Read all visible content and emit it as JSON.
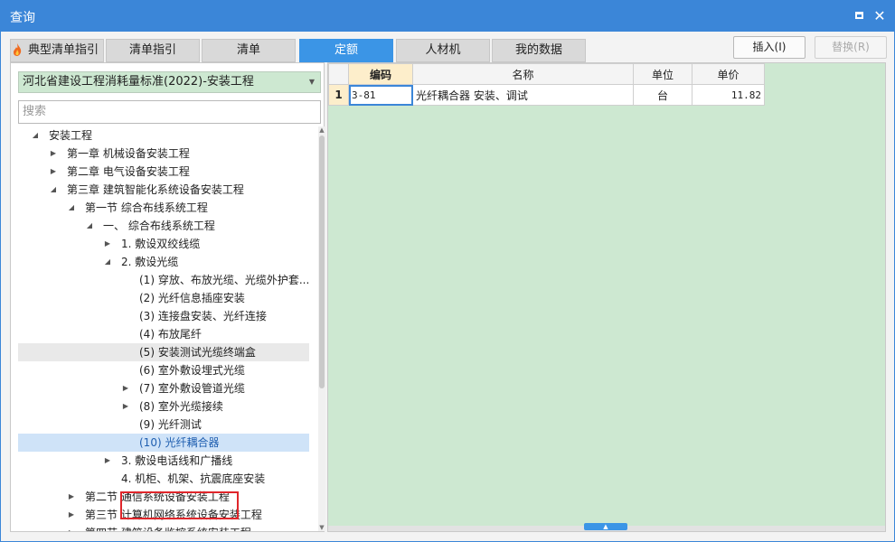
{
  "window": {
    "title": "查询"
  },
  "tabs": [
    {
      "label": "典型清单指引",
      "active": false
    },
    {
      "label": "清单指引",
      "active": false
    },
    {
      "label": "清单",
      "active": false
    },
    {
      "label": "定额",
      "active": true
    },
    {
      "label": "人材机",
      "active": false
    },
    {
      "label": "我的数据",
      "active": false
    }
  ],
  "actions": {
    "insert": "插入(I)",
    "replace": "替换(R)"
  },
  "library": {
    "selected": "河北省建设工程消耗量标准(2022)-安装工程"
  },
  "search": {
    "placeholder": "搜索"
  },
  "tree": [
    {
      "label": "安装工程",
      "indent": 0,
      "arrow": "expanded"
    },
    {
      "label": "第一章 机械设备安装工程",
      "indent": 1,
      "arrow": "collapsed"
    },
    {
      "label": "第二章 电气设备安装工程",
      "indent": 1,
      "arrow": "collapsed"
    },
    {
      "label": "第三章 建筑智能化系统设备安装工程",
      "indent": 1,
      "arrow": "expanded"
    },
    {
      "label": "第一节 综合布线系统工程",
      "indent": 2,
      "arrow": "expanded"
    },
    {
      "label": "一、 综合布线系统工程",
      "indent": 3,
      "arrow": "expanded"
    },
    {
      "label": "1. 敷设双绞线缆",
      "indent": 4,
      "arrow": "collapsed"
    },
    {
      "label": "2. 敷设光缆",
      "indent": 4,
      "arrow": "expanded"
    },
    {
      "label": "(1) 穿放、布放光缆、光缆外护套...",
      "indent": 5,
      "arrow": "none"
    },
    {
      "label": "(2) 光纤信息插座安装",
      "indent": 5,
      "arrow": "none"
    },
    {
      "label": "(3) 连接盘安装、光纤连接",
      "indent": 5,
      "arrow": "none"
    },
    {
      "label": "(4) 布放尾纤",
      "indent": 5,
      "arrow": "none"
    },
    {
      "label": "(5) 安装测试光缆终端盒",
      "indent": 5,
      "arrow": "none",
      "state": "hover"
    },
    {
      "label": "(6) 室外敷设埋式光缆",
      "indent": 5,
      "arrow": "none"
    },
    {
      "label": "(7) 室外敷设管道光缆",
      "indent": 5,
      "arrow": "collapsed"
    },
    {
      "label": "(8) 室外光缆接续",
      "indent": 5,
      "arrow": "collapsed"
    },
    {
      "label": "(9) 光纤测试",
      "indent": 5,
      "arrow": "none"
    },
    {
      "label": "(10) 光纤耦合器",
      "indent": 5,
      "arrow": "none",
      "state": "selected"
    },
    {
      "label": "3. 敷设电话线和广播线",
      "indent": 4,
      "arrow": "collapsed"
    },
    {
      "label": "4. 机柜、机架、抗震底座安装",
      "indent": 4,
      "arrow": "none"
    },
    {
      "label": "第二节 通信系统设备安装工程",
      "indent": 2,
      "arrow": "collapsed"
    },
    {
      "label": "第三节 计算机网络系统设备安装工程",
      "indent": 2,
      "arrow": "collapsed"
    },
    {
      "label": "第四节 建筑设备监控系统安装工程",
      "indent": 2,
      "arrow": "collapsed"
    }
  ],
  "grid": {
    "headers": {
      "code": "编码",
      "name": "名称",
      "unit": "单位",
      "price": "单价"
    },
    "rows": [
      {
        "num": "1",
        "code": "3-81",
        "name": "光纤耦合器 安装、调试",
        "unit": "台",
        "price": "11.82"
      }
    ]
  },
  "icons": {
    "close": "close-icon",
    "maximize": "maximize-icon",
    "fire": "fire-icon"
  },
  "colors": {
    "accent": "#3b95e6",
    "grid_bg": "#cde8d1",
    "highlight": "#e0262b"
  }
}
